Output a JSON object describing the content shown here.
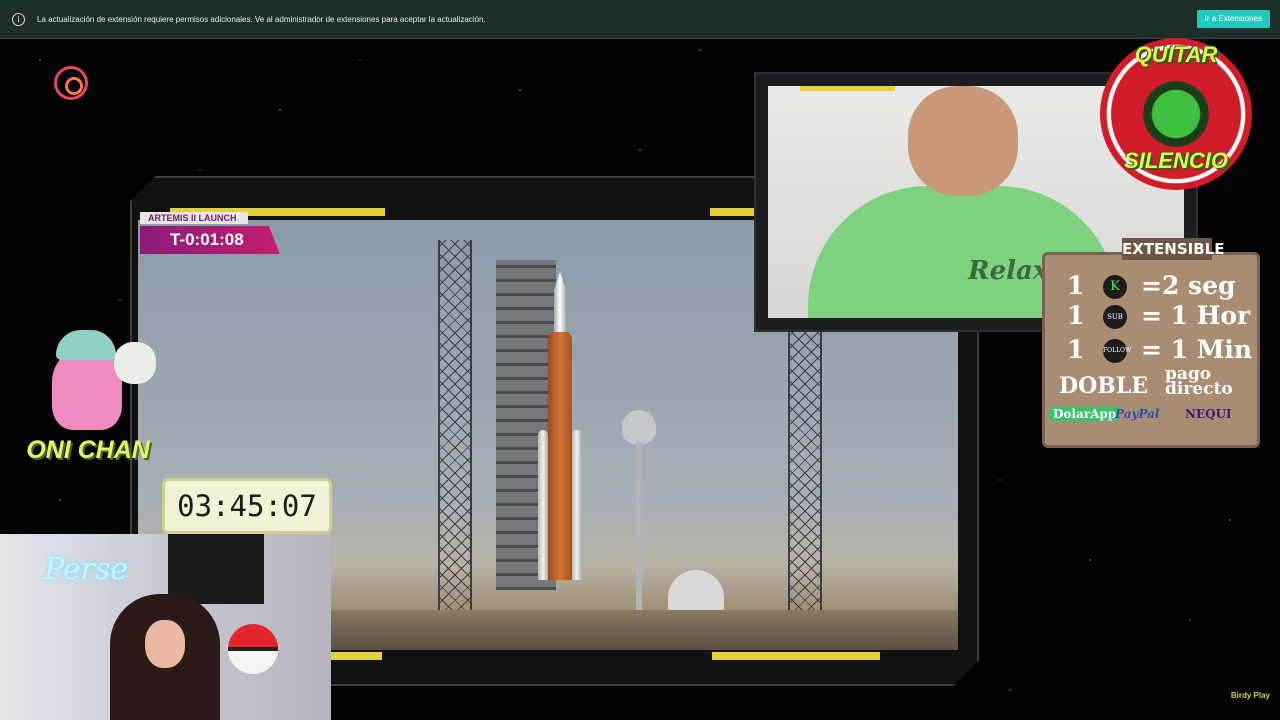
{
  "notification": {
    "message": "La actualización de extensión requiere permisos adicionales. Ve al administrador de extensiones para aceptar la actualización.",
    "button_label": "Ir a Extensiones"
  },
  "stream": {
    "launch_label": "ARTEMIS II LAUNCH",
    "countdown": "T-0:01:08"
  },
  "badge": {
    "line1": "QUITAR",
    "line2": "SILENCIO"
  },
  "shirt_text": "Relax...",
  "panel": {
    "title": "EXTENSIBLE",
    "rows": [
      {
        "qty": "1",
        "icon": "K",
        "value": "=2 seg"
      },
      {
        "qty": "1",
        "icon": "SUB",
        "value": "= 1 Hor"
      },
      {
        "qty": "1",
        "icon": "FOLLOW",
        "value": "= 1 Min"
      }
    ],
    "doble": "DOBLE",
    "pago_line1": "pago",
    "pago_line2": "directo",
    "payments": [
      "DolarApp",
      "PayPal",
      "NEQUI"
    ]
  },
  "avatar_label": "ONI CHAN",
  "timer": "03:45:07",
  "cam2_sign": "Perse",
  "corner_logo": "Birdy Play"
}
